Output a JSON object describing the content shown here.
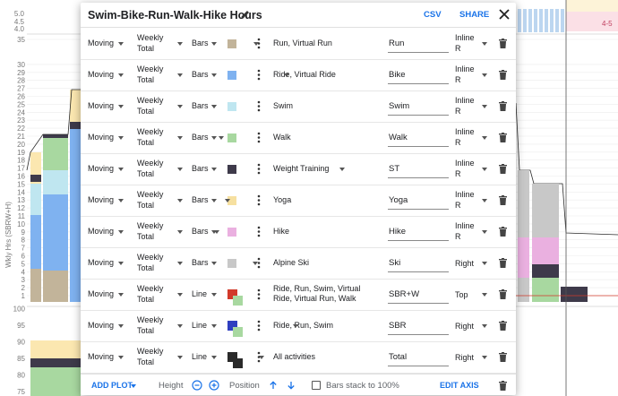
{
  "dialog": {
    "title": "Swim-Bike-Run-Walk-Hike Hours",
    "csv_label": "CSV",
    "share_label": "SHARE"
  },
  "background_chart": {
    "top_panel_ticks": [
      "5.0",
      "4.5",
      "4.0"
    ],
    "top_legend_label": "4-5",
    "main_axis_title": "Wkly Hrs (SBRW+H)",
    "main_ticks": [
      "1",
      "2",
      "3",
      "4",
      "5",
      "6",
      "7",
      "8",
      "9",
      "10",
      "11",
      "12",
      "13",
      "14",
      "15",
      "16",
      "17",
      "18",
      "19",
      "20",
      "21",
      "22",
      "23",
      "24",
      "25",
      "26",
      "27",
      "28",
      "29",
      "30",
      "35"
    ],
    "lower_ticks": [
      "75",
      "80",
      "85",
      "90",
      "95",
      "100"
    ]
  },
  "rows": [
    {
      "metric": "Moving",
      "period": "Weekly Total",
      "type": "Bars",
      "color": "#c2b49a",
      "activity": "Run, Virtual Run",
      "label": "Run",
      "position": "Inline R"
    },
    {
      "metric": "Moving",
      "period": "Weekly Total",
      "type": "Bars",
      "color": "#7fb2f0",
      "activity": "Ride, Virtual Ride",
      "label": "Bike",
      "position": "Inline R"
    },
    {
      "metric": "Moving",
      "period": "Weekly Total",
      "type": "Bars",
      "color": "#bfe6f0",
      "activity": "Swim",
      "label": "Swim",
      "position": "Inline R"
    },
    {
      "metric": "Moving",
      "period": "Weekly Total",
      "type": "Bars",
      "color": "#a8d8a0",
      "activity": "Walk",
      "label": "Walk",
      "position": "Inline R"
    },
    {
      "metric": "Moving",
      "period": "Weekly Total",
      "type": "Bars",
      "color": "#3e3a4a",
      "activity": "Weight Training",
      "label": "ST",
      "position": "Inline R"
    },
    {
      "metric": "Moving",
      "period": "Weekly Total",
      "type": "Bars",
      "color": "#f6e0a0",
      "activity": "Yoga",
      "label": "Yoga",
      "position": "Inline R"
    },
    {
      "metric": "Moving",
      "period": "Weekly Total",
      "type": "Bars",
      "color": "#eab0e0",
      "activity": "Hike",
      "label": "Hike",
      "position": "Inline R"
    },
    {
      "metric": "Moving",
      "period": "Weekly Total",
      "type": "Bars",
      "color": "#c8c8c8",
      "activity": "Alpine Ski",
      "label": "Ski",
      "position": "Right"
    },
    {
      "metric": "Moving",
      "period": "Weekly Total",
      "type": "Line",
      "color": "#d23a2a",
      "color2": "#a8d8a0",
      "activity": "Ride, Run, Swim, Virtual Ride, Virtual Run, Walk",
      "label": "SBR+W",
      "position": "Top"
    },
    {
      "metric": "Moving",
      "period": "Weekly Total",
      "type": "Line",
      "color": "#2f3fc0",
      "color2": "#a8d8a0",
      "activity": "Ride, Run, Swim",
      "label": "SBR",
      "position": "Right"
    },
    {
      "metric": "Moving",
      "period": "Weekly Total",
      "type": "Line",
      "color": "#2a2a2a",
      "color2": "#2a2a2a",
      "activity": "All activities",
      "label": "Total",
      "position": "Right"
    }
  ],
  "footer": {
    "add_plot_label": "ADD PLOT",
    "height_label": "Height",
    "position_label": "Position",
    "stack_label": "Bars stack to 100%",
    "stack_checked": false,
    "edit_axis_label": "EDIT AXIS"
  }
}
